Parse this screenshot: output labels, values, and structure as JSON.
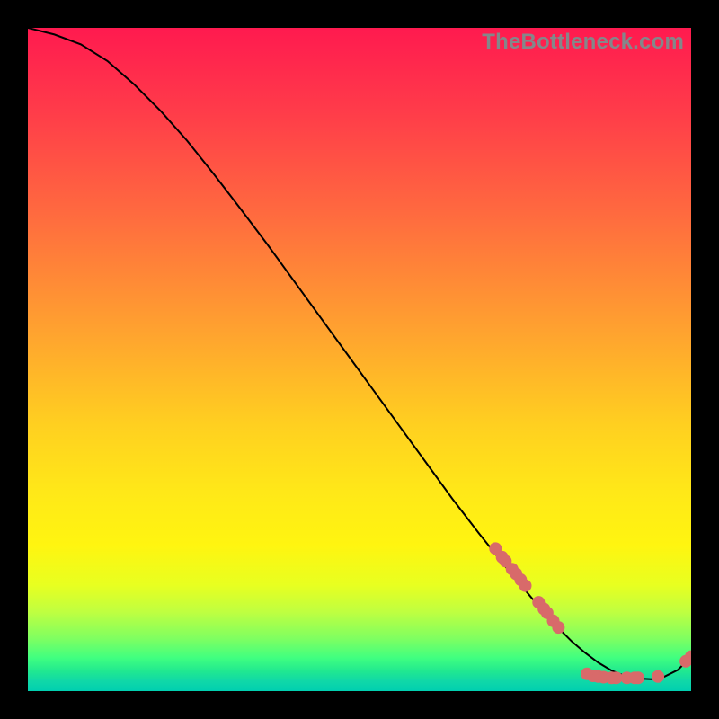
{
  "watermark": "TheBottleneck.com",
  "colors": {
    "dot": "#d86a6a",
    "curve": "#000000",
    "background": "#000000"
  },
  "chart_data": {
    "type": "line",
    "title": "",
    "xlabel": "",
    "ylabel": "",
    "xlim": [
      0,
      100
    ],
    "ylim": [
      0,
      100
    ],
    "grid": false,
    "legend": false,
    "series": [
      {
        "name": "curve",
        "x": [
          0,
          4,
          8,
          12,
          16,
          20,
          24,
          28,
          32,
          36,
          40,
          44,
          48,
          52,
          56,
          60,
          64,
          68,
          72,
          76,
          80,
          82,
          84,
          86,
          88,
          90,
          92,
          94,
          96,
          98,
          100
        ],
        "y": [
          100,
          99,
          97.5,
          95,
          91.5,
          87.5,
          83,
          78,
          72.8,
          67.5,
          62,
          56.5,
          51,
          45.5,
          40,
          34.5,
          29,
          23.8,
          18.8,
          14,
          9.5,
          7.5,
          5.8,
          4.3,
          3.1,
          2.3,
          1.9,
          1.8,
          2.2,
          3.2,
          5.2
        ]
      }
    ],
    "points": [
      {
        "x": 70.5,
        "y": 21.5
      },
      {
        "x": 71.5,
        "y": 20.2
      },
      {
        "x": 72.0,
        "y": 19.6
      },
      {
        "x": 73.0,
        "y": 18.4
      },
      {
        "x": 73.6,
        "y": 17.7
      },
      {
        "x": 74.3,
        "y": 16.8
      },
      {
        "x": 75.0,
        "y": 15.9
      },
      {
        "x": 77.0,
        "y": 13.4
      },
      {
        "x": 77.8,
        "y": 12.4
      },
      {
        "x": 78.3,
        "y": 11.8
      },
      {
        "x": 79.2,
        "y": 10.6
      },
      {
        "x": 80.0,
        "y": 9.6
      },
      {
        "x": 84.3,
        "y": 2.6
      },
      {
        "x": 85.2,
        "y": 2.3
      },
      {
        "x": 86.0,
        "y": 2.2
      },
      {
        "x": 86.8,
        "y": 2.1
      },
      {
        "x": 88.0,
        "y": 2.0
      },
      {
        "x": 88.7,
        "y": 2.0
      },
      {
        "x": 90.3,
        "y": 2.0
      },
      {
        "x": 91.5,
        "y": 2.0
      },
      {
        "x": 92.0,
        "y": 2.0
      },
      {
        "x": 95.0,
        "y": 2.2
      },
      {
        "x": 99.2,
        "y": 4.5
      },
      {
        "x": 100.0,
        "y": 5.2
      }
    ]
  }
}
